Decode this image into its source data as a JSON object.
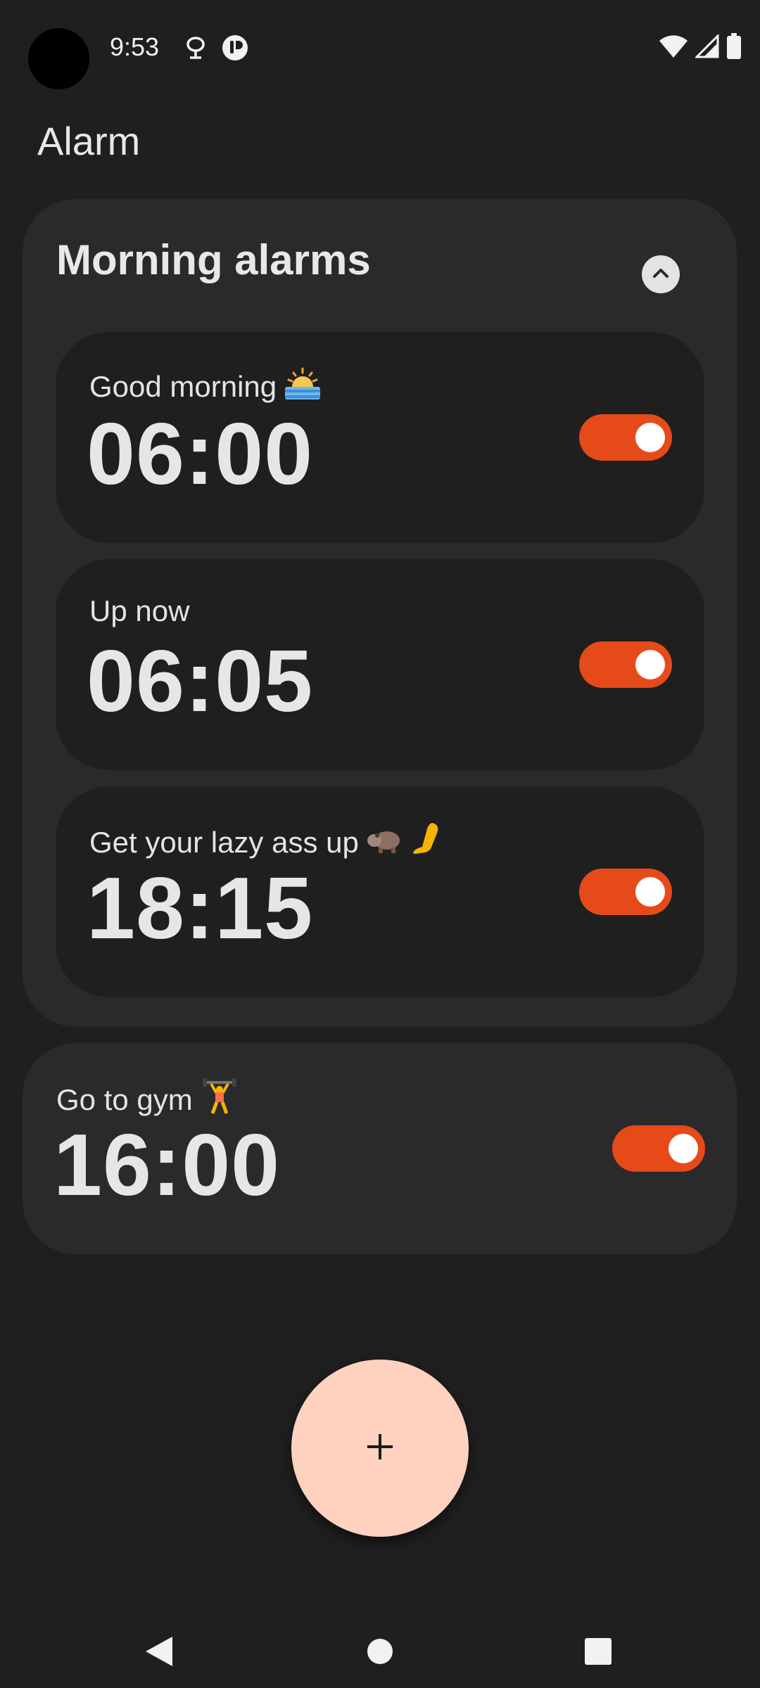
{
  "status_bar": {
    "time": "9:53",
    "left_icons": [
      "tree-icon",
      "app-notification-icon"
    ],
    "right_icons": [
      "wifi-icon",
      "cellular-signal-icon",
      "battery-icon"
    ]
  },
  "app": {
    "title": "Alarm"
  },
  "group": {
    "title": "Morning alarms",
    "collapse_icon": "chevron-up-icon",
    "alarms": [
      {
        "label": "Good morning",
        "emoji": "sunrise-emoji",
        "time": "06:00",
        "enabled": true
      },
      {
        "label": "Up now",
        "emoji": "",
        "time": "06:05",
        "enabled": true
      },
      {
        "label": "Get your lazy ass up",
        "emoji": "hippo-leg-emoji",
        "time": "18:15",
        "enabled": true
      }
    ]
  },
  "standalone_alarm": {
    "label": "Go to gym",
    "emoji": "weightlifter-emoji",
    "time": "16:00",
    "enabled": true
  },
  "fab": {
    "icon": "plus-icon"
  },
  "nav": {
    "back_icon": "back-triangle-icon",
    "home_icon": "home-circle-icon",
    "recents_icon": "recents-square-icon"
  },
  "colors": {
    "background": "#1f1f1f",
    "card": "#2a2a2d",
    "inner_card": "#1f1f20",
    "toggle_on": "#e64a19",
    "fab": "#ffd1bf"
  }
}
